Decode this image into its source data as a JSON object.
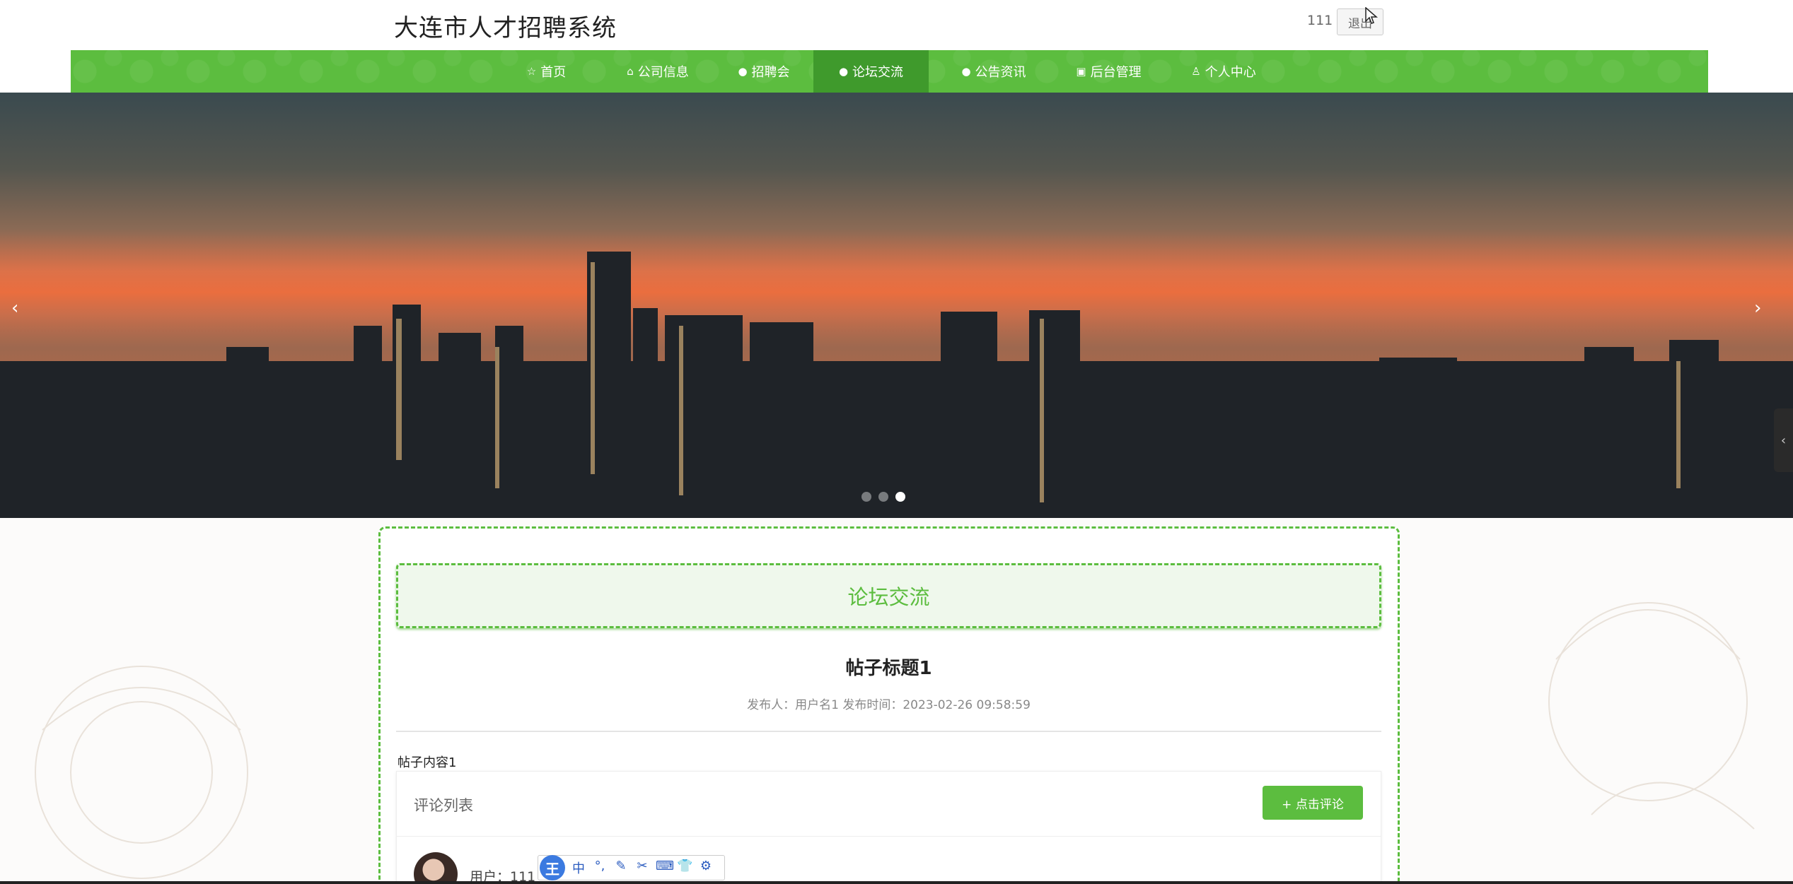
{
  "header": {
    "site_title": "大连市人才招聘系统",
    "username": "111",
    "logout_label": "退出"
  },
  "nav": {
    "items": [
      {
        "label": "首页",
        "icon": "star-icon",
        "glyph": "☆"
      },
      {
        "label": "公司信息",
        "icon": "bag-icon",
        "glyph": "⌂"
      },
      {
        "label": "招聘会",
        "icon": "info-icon",
        "glyph": "●"
      },
      {
        "label": "论坛交流",
        "icon": "info-icon",
        "glyph": "●"
      },
      {
        "label": "公告资讯",
        "icon": "info-icon",
        "glyph": "●"
      },
      {
        "label": "后台管理",
        "icon": "briefcase-icon",
        "glyph": "▣"
      },
      {
        "label": "个人中心",
        "icon": "person-icon",
        "glyph": "♙"
      }
    ],
    "active_index": 3
  },
  "banner": {
    "arrow_left": "‹",
    "arrow_right": "›",
    "slide_count": 3,
    "active_slide": 2,
    "side_tab_glyph": "‹"
  },
  "forum": {
    "section_title": "论坛交流",
    "post_title": "帖子标题1",
    "post_meta": "发布人：用户名1  发布时间：2023-02-26 09:58:59",
    "post_content": "帖子内容1"
  },
  "comments": {
    "header_title": "评论列表",
    "add_button_label": "+ 点击评论",
    "first_user_label": "用户：111"
  },
  "ime": {
    "logo": "王",
    "buttons": [
      "中",
      "°,",
      "✎",
      "✂",
      "⌨",
      "👕",
      "⚙"
    ]
  },
  "colors": {
    "accent": "#5cbd3f",
    "accent_dark": "#3f9a2c"
  }
}
